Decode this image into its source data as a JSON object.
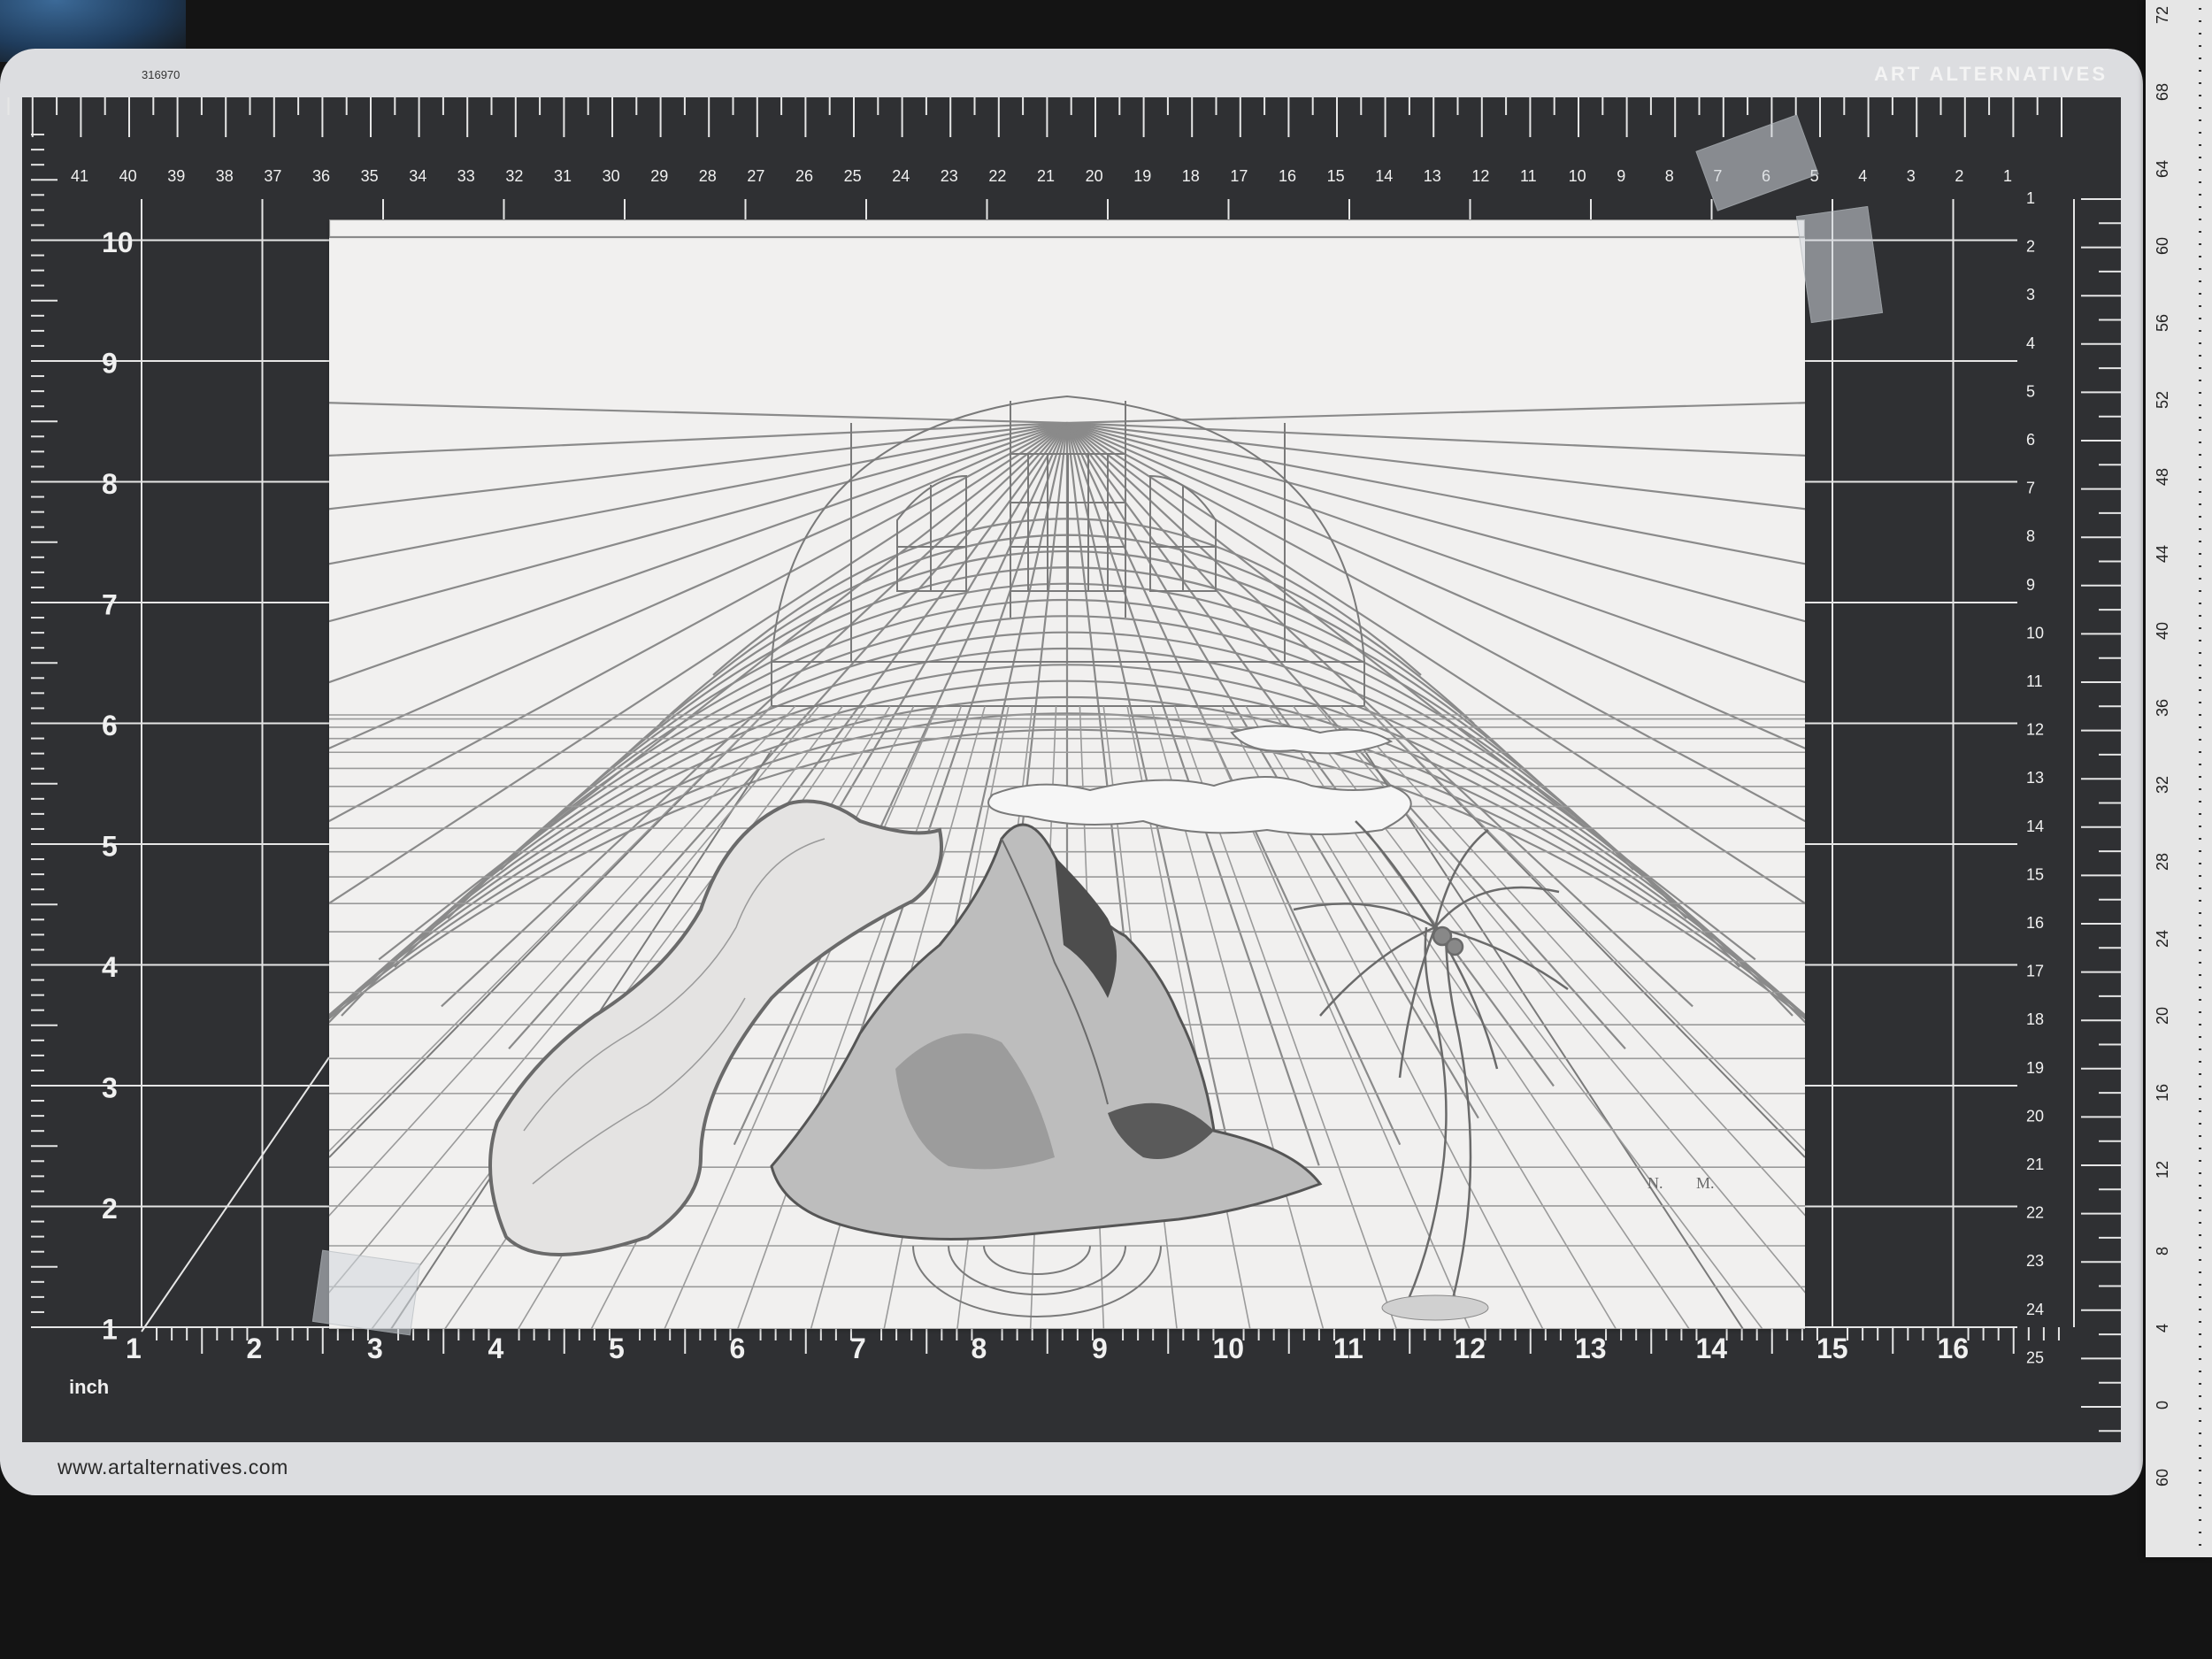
{
  "mat": {
    "brand": "ART ALTERNATIVES",
    "serial": "316970",
    "website": "www.artalternatives.com",
    "unit_label": "inch",
    "bottom_inch_numbers": [
      "1",
      "2",
      "3",
      "4",
      "5",
      "6",
      "7",
      "8",
      "9",
      "10",
      "11",
      "12",
      "13",
      "14",
      "15",
      "16"
    ],
    "left_inch_numbers": [
      "10",
      "9",
      "8",
      "7",
      "6",
      "5",
      "4",
      "3",
      "2",
      "1"
    ],
    "top_cm_numbers": [
      "41",
      "40",
      "39",
      "38",
      "37",
      "36",
      "35",
      "34",
      "33",
      "32",
      "31",
      "30",
      "29",
      "28",
      "27",
      "26",
      "25",
      "24",
      "23",
      "22",
      "21",
      "20",
      "19",
      "18",
      "17",
      "16",
      "15",
      "14",
      "13",
      "12",
      "11",
      "10",
      "9",
      "8",
      "7",
      "6",
      "5",
      "4",
      "3",
      "2",
      "1"
    ],
    "right_cm_numbers": [
      "1",
      "2",
      "3",
      "4",
      "5",
      "6",
      "7",
      "8",
      "9",
      "10",
      "11",
      "12",
      "13",
      "14",
      "15",
      "16",
      "17",
      "18",
      "19",
      "20",
      "21",
      "22",
      "23",
      "24",
      "25"
    ]
  },
  "side_ruler": {
    "numbers": [
      "72",
      "68",
      "64",
      "60",
      "56",
      "52",
      "48",
      "44",
      "40",
      "36",
      "32",
      "28",
      "24",
      "20",
      "16",
      "12",
      "8",
      "4",
      "0",
      "60"
    ]
  },
  "drawing": {
    "subject": "pencil perspective drawing of a vaulted hall with a river, a mountain and a palm tree",
    "initials": [
      "N.",
      "M."
    ]
  },
  "colors": {
    "mat_dark": "#2f3033",
    "mat_frame": "#dcdde0",
    "grid_line": "#e8e8e8",
    "paper": "#f1f0ef",
    "pencil": "#7a7a7a",
    "background": "#141414"
  }
}
